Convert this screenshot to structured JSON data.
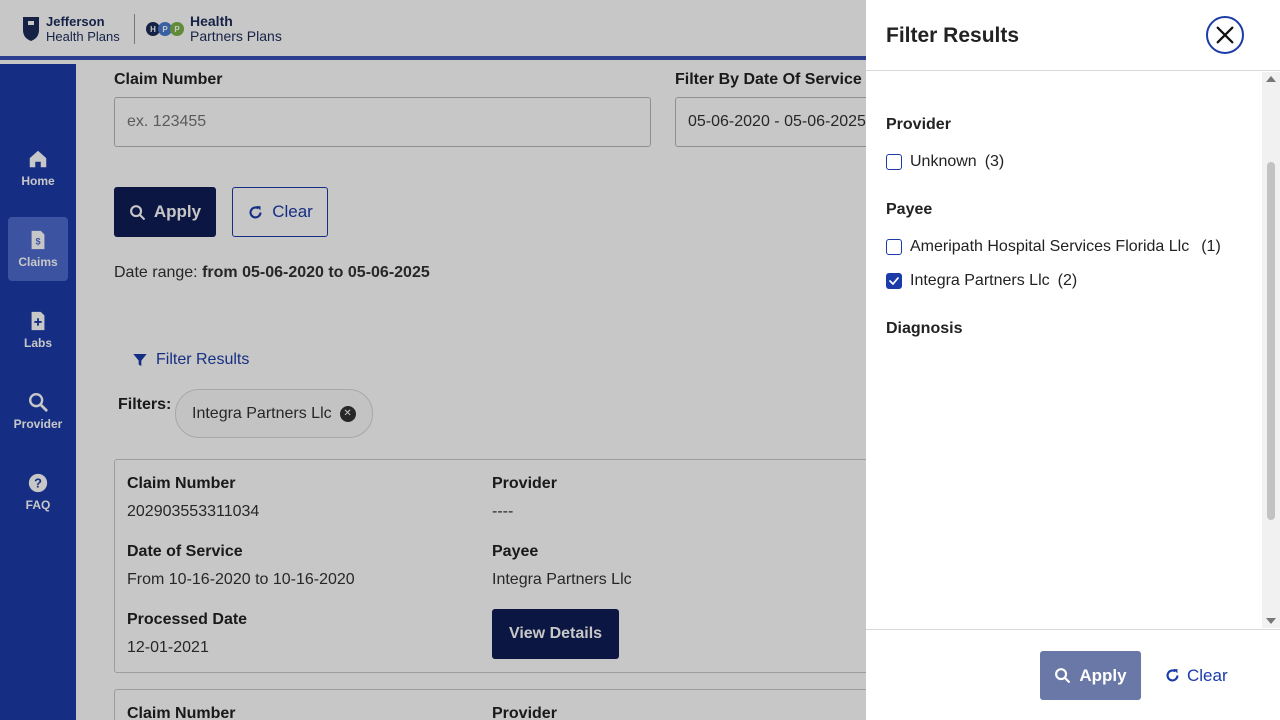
{
  "header": {
    "logo1_line1": "Jefferson",
    "logo1_line2": "Health Plans",
    "logo2_dots": [
      "H",
      "P",
      "P"
    ],
    "logo2_line1": "Health",
    "logo2_line2": "Partners Plans"
  },
  "sidebar": {
    "items": [
      {
        "label": "Home",
        "icon": "home-icon",
        "active": false
      },
      {
        "label": "Claims",
        "icon": "claims-icon",
        "active": true
      },
      {
        "label": "Labs",
        "icon": "labs-icon",
        "active": false
      },
      {
        "label": "Provider",
        "icon": "search-icon",
        "active": false
      },
      {
        "label": "FAQ",
        "icon": "question-icon",
        "active": false
      }
    ]
  },
  "search": {
    "claim_number_label": "Claim Number",
    "claim_number_placeholder": "ex. 123455",
    "date_label": "Filter By Date Of Service",
    "date_value": "05-06-2020 - 05-06-2025",
    "apply_label": "Apply",
    "clear_label": "Clear",
    "date_range_prefix": "Date range:",
    "date_range_value": "from 05-06-2020 to 05-06-2025"
  },
  "filters": {
    "filter_results_link": "Filter Results",
    "filters_label": "Filters:",
    "chips": [
      "Integra Partners Llc"
    ]
  },
  "claims": [
    {
      "claim_number_label": "Claim Number",
      "claim_number": "202903553311034",
      "provider_label": "Provider",
      "provider": "----",
      "dos_label": "Date of Service",
      "dos": "From 10-16-2020 to 10-16-2020",
      "payee_label": "Payee",
      "payee": "Integra Partners Llc",
      "processed_label": "Processed Date",
      "processed": "12-01-2021",
      "view_details_label": "View Details"
    },
    {
      "claim_number_label": "Claim Number",
      "provider_label": "Provider"
    }
  ],
  "drawer": {
    "title": "Filter Results",
    "provider_section": "Provider",
    "provider_options": [
      {
        "name": "Unknown",
        "count": "(3)",
        "checked": false
      }
    ],
    "payee_section": "Payee",
    "payee_options": [
      {
        "name": "Ameripath Hospital Services Florida Llc",
        "count": "(1)",
        "checked": false
      },
      {
        "name": "Integra Partners Llc",
        "count": "(2)",
        "checked": true
      }
    ],
    "diagnosis_section": "Diagnosis",
    "apply_label": "Apply",
    "clear_label": "Clear"
  },
  "colors": {
    "brand_blue": "#1b3ca8",
    "navy": "#0f1d55",
    "active_nav": "#4e6bd0"
  }
}
